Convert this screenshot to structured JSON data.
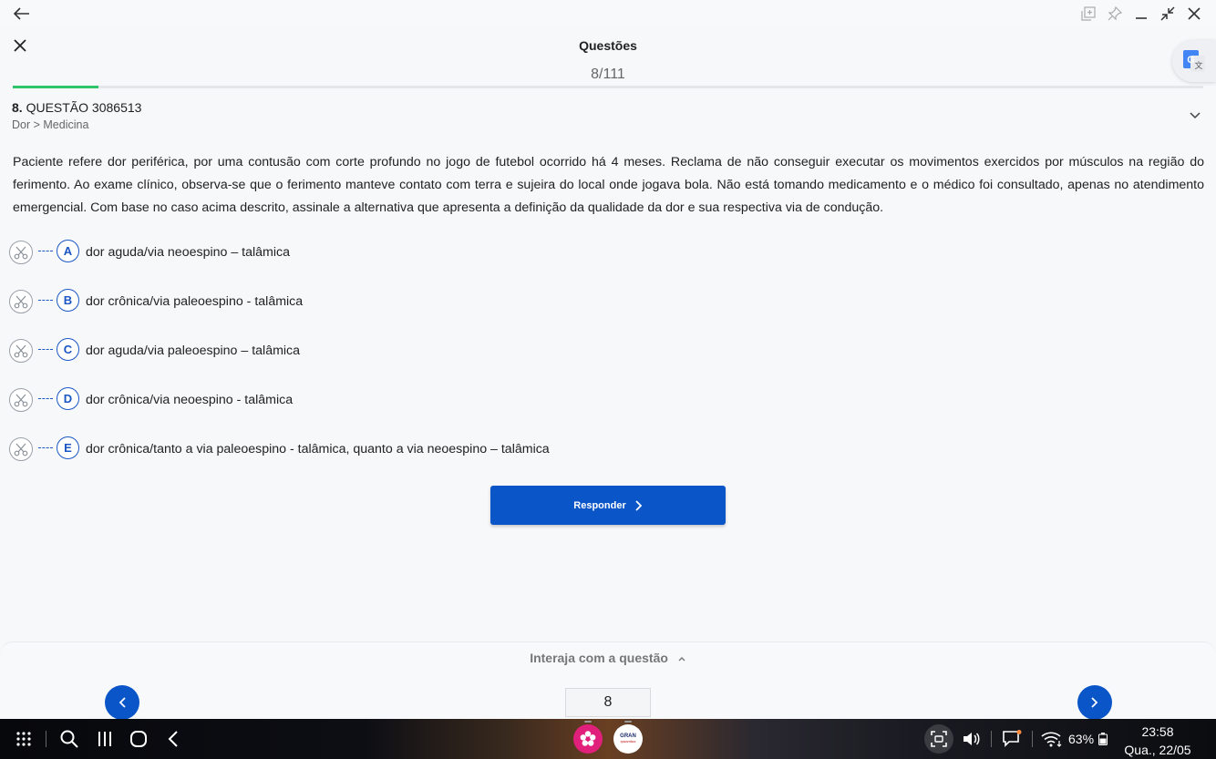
{
  "window": {
    "back_icon": "arrow-left-icon",
    "controls": [
      "copy-window-icon",
      "pin-icon",
      "minimize-icon",
      "collapse-icon",
      "close-icon"
    ]
  },
  "header": {
    "title": "Questões",
    "counter": "8/111",
    "progress_fraction": 0.072
  },
  "question": {
    "number": "8.",
    "code": "QUESTÃO 3086513",
    "category": "Dor > Medicina",
    "statement": "Paciente refere dor periférica, por uma contusão com corte profundo no jogo de futebol ocorrido há 4 meses. Reclama de não conseguir executar os movimentos exercidos por músculos na região do ferimento. Ao exame clínico, observa-se que o ferimento manteve contato com terra e sujeira do local onde jogava bola. Não está tomando medicamento e o médico foi consultado, apenas no atendimento emergencial. Com base no caso acima descrito, assinale a alternativa que apresenta a definição da qualidade da dor e sua respectiva via de condução.",
    "alternatives": [
      {
        "letter": "A",
        "text": "dor aguda/via neoespino – talâmica"
      },
      {
        "letter": "B",
        "text": "dor crônica/via paleoespino - talâmica"
      },
      {
        "letter": "C",
        "text": "dor aguda/via paleoespino – talâmica"
      },
      {
        "letter": "D",
        "text": "dor crônica/via neoespino - talâmica"
      },
      {
        "letter": "E",
        "text": "dor crônica/tanto a via paleoespino - talâmica, quanto a via neoespino – talâmica"
      }
    ]
  },
  "actions": {
    "respond_label": "Responder"
  },
  "bottom": {
    "interact_label": "Interaja com a questão",
    "page_value": "8"
  },
  "taskbar": {
    "battery": "63%",
    "time": "23:58",
    "date": "Qua., 22/05",
    "app2_label_top": "GRAN",
    "app2_label_bottom": "QUESTÕES"
  },
  "colors": {
    "primary": "#0a55c8",
    "progress": "#2ec56b"
  }
}
